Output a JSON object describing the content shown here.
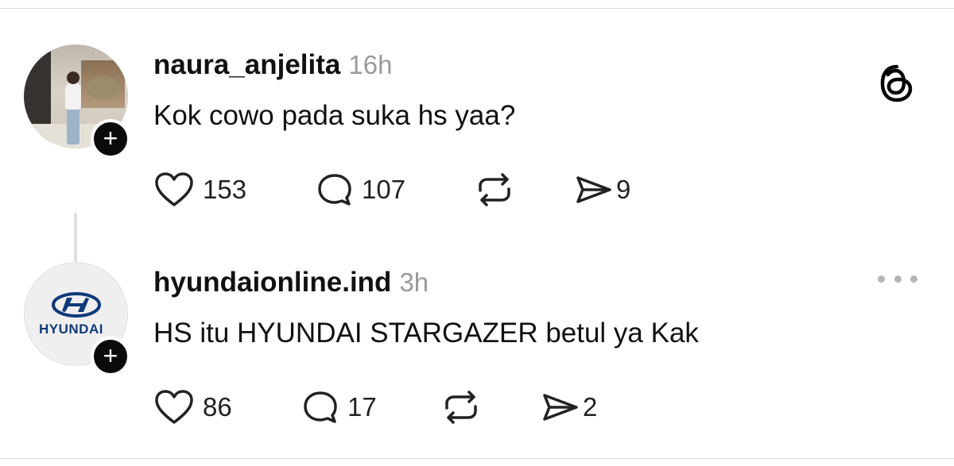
{
  "posts": [
    {
      "username": "naura_anjelita",
      "time": "16h",
      "text": "Kok cowo pada suka hs yaa?",
      "likes": "153",
      "replies": "107",
      "shares": "9",
      "avatar_icon": "profile-photo",
      "follow_icon": "plus-icon"
    },
    {
      "username": "hyundaionline.ind",
      "time": "3h",
      "text": "HS itu HYUNDAI STARGAZER betul ya Kak",
      "likes": "86",
      "replies": "17",
      "shares": "2",
      "avatar_icon": "hyundai-logo",
      "avatar_text": "HYUNDAI",
      "follow_icon": "plus-icon"
    }
  ],
  "app": {
    "logo_icon": "threads-logo-icon",
    "more_icon": "more-options-icon"
  },
  "icons": {
    "like": "heart-icon",
    "reply": "comment-icon",
    "repost": "repost-icon",
    "share": "send-icon"
  },
  "colors": {
    "text": "#111111",
    "muted": "#9a9a9a",
    "badge": "#0b0b0b"
  }
}
